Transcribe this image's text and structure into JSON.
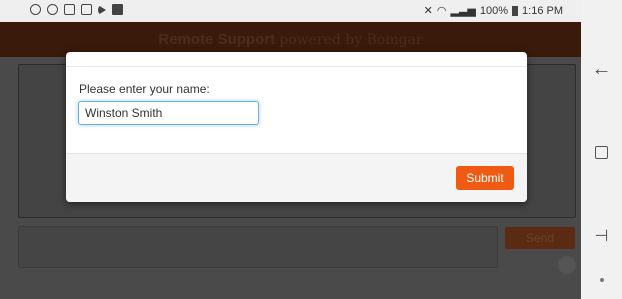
{
  "statusbar": {
    "left_icons": [
      "nfc-icon",
      "nfc-icon",
      "image-icon",
      "document-icon",
      "play-icon",
      "facebook-icon"
    ],
    "battery": "100%",
    "time": "1:16 PM"
  },
  "app": {
    "title_bold": "Remote Support",
    "title_sub": "powered by Bomgar",
    "send_label": "Send"
  },
  "modal": {
    "prompt": "Please enter your name:",
    "name_value": "Winston Smith",
    "submit_label": "Submit"
  },
  "colors": {
    "accent": "#ef5b12",
    "focus": "#66afe9"
  }
}
